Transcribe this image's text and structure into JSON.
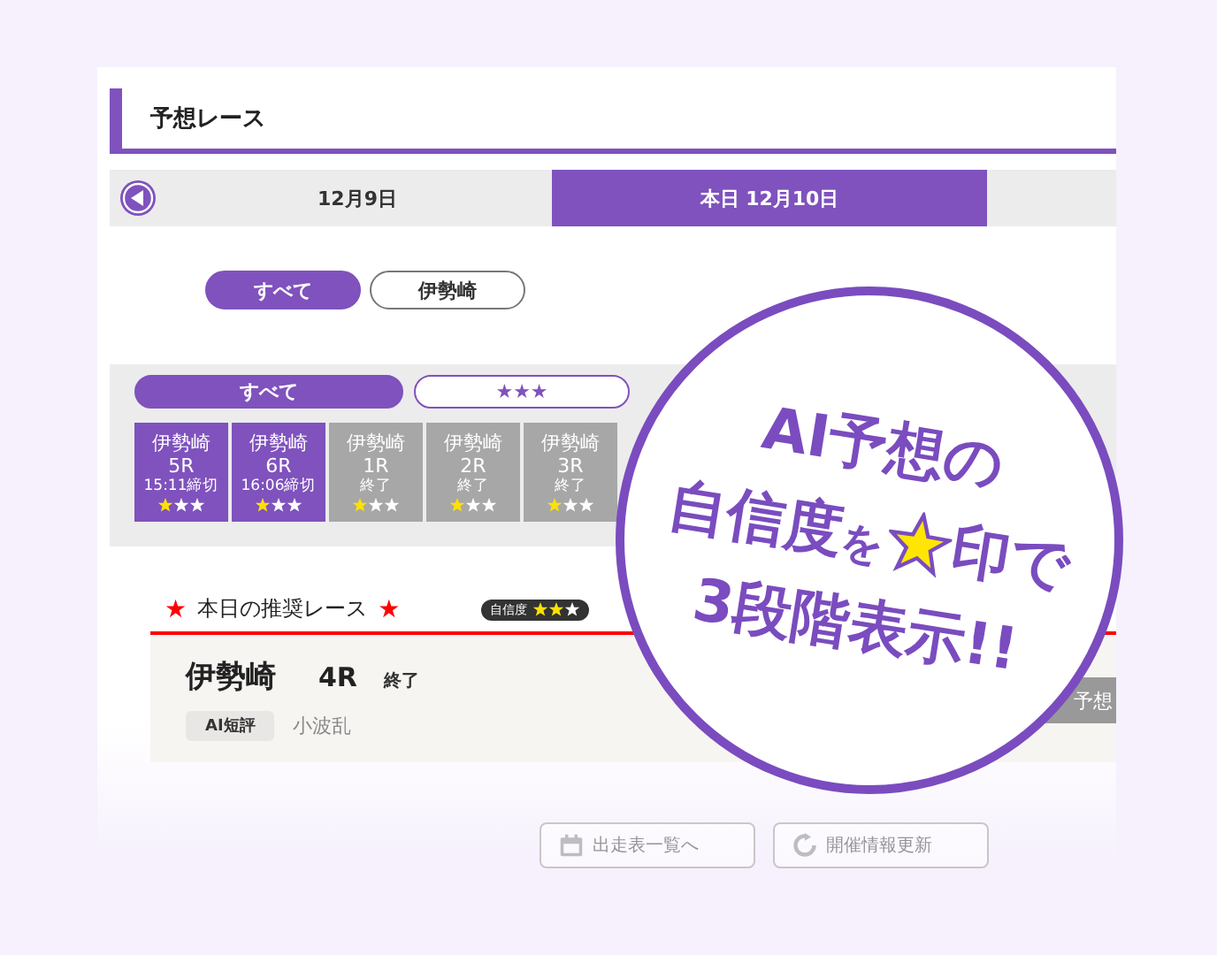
{
  "section_title": "予想レース",
  "dates": [
    {
      "label": "12月9日",
      "selected": false
    },
    {
      "label": "本日 12月10日",
      "selected": true
    }
  ],
  "venue_chips": [
    {
      "label": "すべて",
      "selected": true
    },
    {
      "label": "伊勢崎",
      "selected": false
    }
  ],
  "confidence_tabs": [
    {
      "label": "すべて",
      "selected": true
    },
    {
      "label": "★★★",
      "selected": false
    }
  ],
  "races": [
    {
      "venue": "伊勢崎",
      "race": "5R",
      "status": "15:11締切",
      "finished": false,
      "stars": 1
    },
    {
      "venue": "伊勢崎",
      "race": "6R",
      "status": "16:06締切",
      "finished": false,
      "stars": 1
    },
    {
      "venue": "伊勢崎",
      "race": "1R",
      "status": "終了",
      "finished": true,
      "stars": 1
    },
    {
      "venue": "伊勢崎",
      "race": "2R",
      "status": "終了",
      "finished": true,
      "stars": 1
    },
    {
      "venue": "伊勢崎",
      "race": "3R",
      "status": "終了",
      "finished": true,
      "stars": 1
    }
  ],
  "recommended": {
    "heading_mark": "★",
    "heading": "本日の推奨レース",
    "badge_label": "自信度",
    "stars": 2,
    "venue": "伊勢崎",
    "race": "4R",
    "status": "終了",
    "comment_label": "AI短評",
    "comment": "小波乱",
    "forecast_button": "予想"
  },
  "bottom_buttons": [
    "出走表一覧へ",
    "開催情報更新"
  ],
  "callout": {
    "line1": "AI予想の",
    "line2_start": "自信度",
    "line2_particle": "を",
    "line2_end": "印で",
    "line3": "3段階表示!!"
  }
}
